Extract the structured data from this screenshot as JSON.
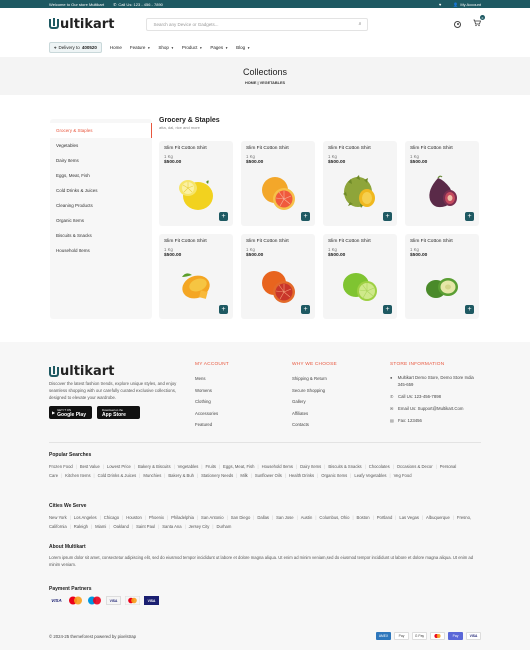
{
  "topbar": {
    "welcome": "Welcome to Our store Multikart",
    "call": "Call Us: 123 - 456 - 7890",
    "account": "My Account"
  },
  "header": {
    "logo_text": "ultikart",
    "search_placeholder": "Search any Device or Gadgets...",
    "cart_count": "0"
  },
  "nav": {
    "delivery_prefix": "Delivery to",
    "delivery_code": "400520",
    "items": [
      "Home",
      "Feature",
      "Shop",
      "Product",
      "Pages",
      "Blog"
    ]
  },
  "hero": {
    "title": "Collections",
    "crumb_home": "HOME",
    "crumb_sep": "|",
    "crumb_current": "VEGETABLES"
  },
  "sidebar": {
    "categories": [
      "Grocery & Staples",
      "Vegetables",
      "Dairy Items",
      "Eggs, Meat, Fish",
      "Cold Drinks & Juices",
      "Cleaning Products",
      "Organic Items",
      "Biscuits & Snacks",
      "Household Items"
    ]
  },
  "content": {
    "title": "Grocery & Staples",
    "subtitle": "atta, dal, rice and more"
  },
  "products": [
    {
      "name": "Slim Fit Cotton Shirt",
      "weight": "1 Kg",
      "price": "$500.00",
      "fruit": "lemon"
    },
    {
      "name": "Slim Fit Cotton Shirt",
      "weight": "1 Kg",
      "price": "$500.00",
      "fruit": "grapefruit"
    },
    {
      "name": "Slim Fit Cotton Shirt",
      "weight": "1 Kg",
      "price": "$500.00",
      "fruit": "durian"
    },
    {
      "name": "Slim Fit Cotton Shirt",
      "weight": "1 Kg",
      "price": "$500.00",
      "fruit": "fig"
    },
    {
      "name": "Slim Fit Cotton Shirt",
      "weight": "1 Kg",
      "price": "$500.00",
      "fruit": "mango"
    },
    {
      "name": "Slim Fit Cotton Shirt",
      "weight": "1 Kg",
      "price": "$500.00",
      "fruit": "blood-orange"
    },
    {
      "name": "Slim Fit Cotton Shirt",
      "weight": "1 Kg",
      "price": "$500.00",
      "fruit": "lime"
    },
    {
      "name": "Slim Fit Cotton Shirt",
      "weight": "1 Kg",
      "price": "$500.00",
      "fruit": "feijoa"
    }
  ],
  "footer": {
    "about": "Discover the latest fashion trends, explore unique styles, and enjoy seamless shopping with our carefully curated exclusive collections, designed to elevate your wardrobe.",
    "google_small": "GET IT ON",
    "google_big": "Google Play",
    "apple_small": "Download on the",
    "apple_big": "App Store",
    "my_account_title": "MY ACCOUNT",
    "my_account": [
      "Mens",
      "Womens",
      "Clothing",
      "Accessories",
      "Featured"
    ],
    "why_title": "WHY WE CHOOSE",
    "why": [
      "Shipping & Return",
      "Secure Shopping",
      "Gallery",
      "Affiliates",
      "Contacts"
    ],
    "store_title": "STORE INFORMATION",
    "store_address": "Multikart Demo Store, Demo Store India 345-659",
    "store_phone": "Call Us: 123-456-7898",
    "store_email": "Email Us: Support@Multikart.Com",
    "store_fax": "Fax: 123456",
    "popular_title": "Popular Searches",
    "popular": [
      "Frozen Food",
      "Best Value",
      "Lowest Price",
      "Bakery & Biscuits",
      "Vegetables",
      "Fruits",
      "Eggs, Meat, Fish",
      "Household Items",
      "Dairy Items",
      "Biscuits & Snacks",
      "Chocolates",
      "Occasions & Decor",
      "Personal Care",
      "Kitchen Items",
      "Cold Drinks & Juices",
      "Munchies",
      "Bakery & Buh",
      "Stationery Needs",
      "Milk",
      "Sunflower Oils",
      "Health Drinks",
      "Organic Items",
      "Leafy Vegetables",
      "Veg Food"
    ],
    "cities_title": "Cities We Serve",
    "cities": [
      "New York",
      "Los Angeles",
      "Chicago",
      "Houston",
      "Phoenix",
      "Philadelphia",
      "San Antonio",
      "San Diego",
      "Dallas",
      "San Jose",
      "Austin",
      "Columbus, Ohio",
      "Boston",
      "Portland",
      "Las Vegas",
      "Albuquerque",
      "Fresno, California",
      "Raleigh",
      "Miami",
      "Oakland",
      "Saint Paul",
      "Santa Ana",
      "Jersey City",
      "Durham"
    ],
    "about_title": "About Multikart",
    "about_text": "Lorem ipsum dolor sit amet, consectetur adipiscing elit, sed do eiusmod tempor incididunt ut labore et dolore magna aliqua. Ut enim ad minim veniam,sed do eiusmod tempor incididunt ut labore et dolore magna aliqua. Ut enim ad minim veniam.",
    "payment_title": "Payment Partners",
    "copyright": "© 2024-25 themeforest powered by pixelstrap",
    "pay_bottom": [
      "AMEX",
      "Pay",
      "G Pay",
      "",
      "Pay",
      "VISA"
    ]
  },
  "colors": {
    "accent": "#1e5962",
    "highlight": "#e8573e"
  }
}
